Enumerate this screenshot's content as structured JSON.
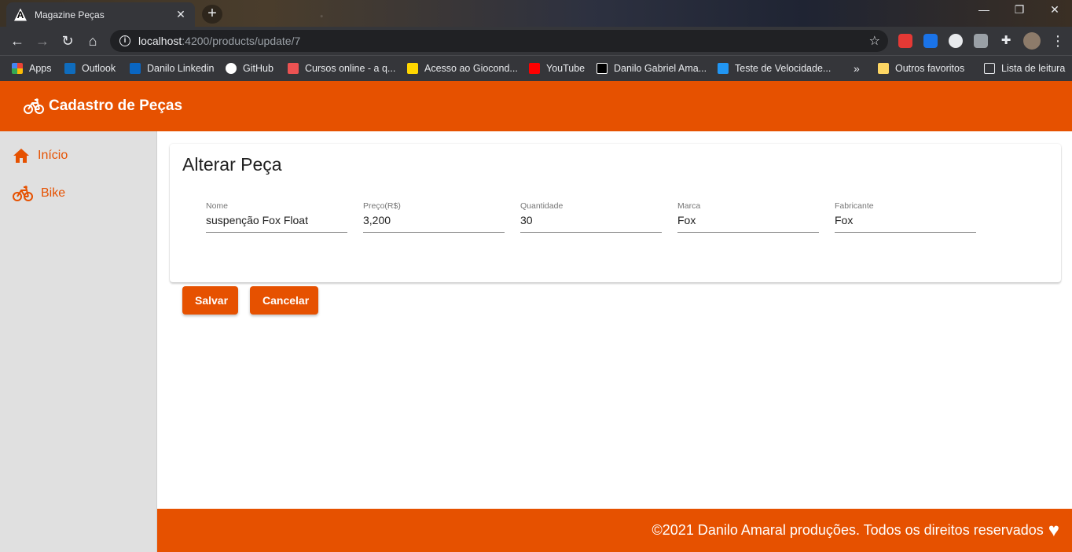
{
  "browser": {
    "tab_title": "Magazine Peças",
    "tab_favicon": "A",
    "url_host": "localhost",
    "url_path": ":4200/products/update/7",
    "bookmarks": [
      {
        "label": "Apps",
        "color": "#ea4335"
      },
      {
        "label": "Outlook",
        "color": "#0f6cbd"
      },
      {
        "label": "Danilo Linkedin",
        "color": "#0a66c2"
      },
      {
        "label": "GitHub",
        "color": "#ffffff"
      },
      {
        "label": "Cursos online - a q...",
        "color": "#ec5252"
      },
      {
        "label": "Acesso ao Giocond...",
        "color": "#ffd600"
      },
      {
        "label": "YouTube",
        "color": "#ff0000"
      },
      {
        "label": "Danilo Gabriel Ama...",
        "color": "#000000"
      },
      {
        "label": "Teste de Velocidade...",
        "color": "#2196f3"
      }
    ],
    "overflow_label": "»",
    "other_bookmarks": "Outros favoritos",
    "reading_list": "Lista de leitura"
  },
  "header": {
    "title": "Cadastro de Peças",
    "icon": "bicycle-icon",
    "color": "#e65100"
  },
  "sidenav": {
    "items": [
      {
        "label": "Início",
        "icon": "home-icon"
      },
      {
        "label": "Bike",
        "icon": "bicycle-icon"
      }
    ]
  },
  "form": {
    "title": "Alterar Peça",
    "fields": [
      {
        "label": "Nome",
        "value": "suspenção Fox Float"
      },
      {
        "label": "Preço(R$)",
        "value": "3,200"
      },
      {
        "label": "Quantidade",
        "value": "30"
      },
      {
        "label": "Marca",
        "value": "Fox"
      },
      {
        "label": "Fabricante",
        "value": "Fox"
      }
    ],
    "save_label": "Salvar",
    "cancel_label": "Cancelar"
  },
  "footer": {
    "text": "©2021 Danilo Amaral produções. Todos os direitos reservados",
    "icon": "heart-icon"
  }
}
